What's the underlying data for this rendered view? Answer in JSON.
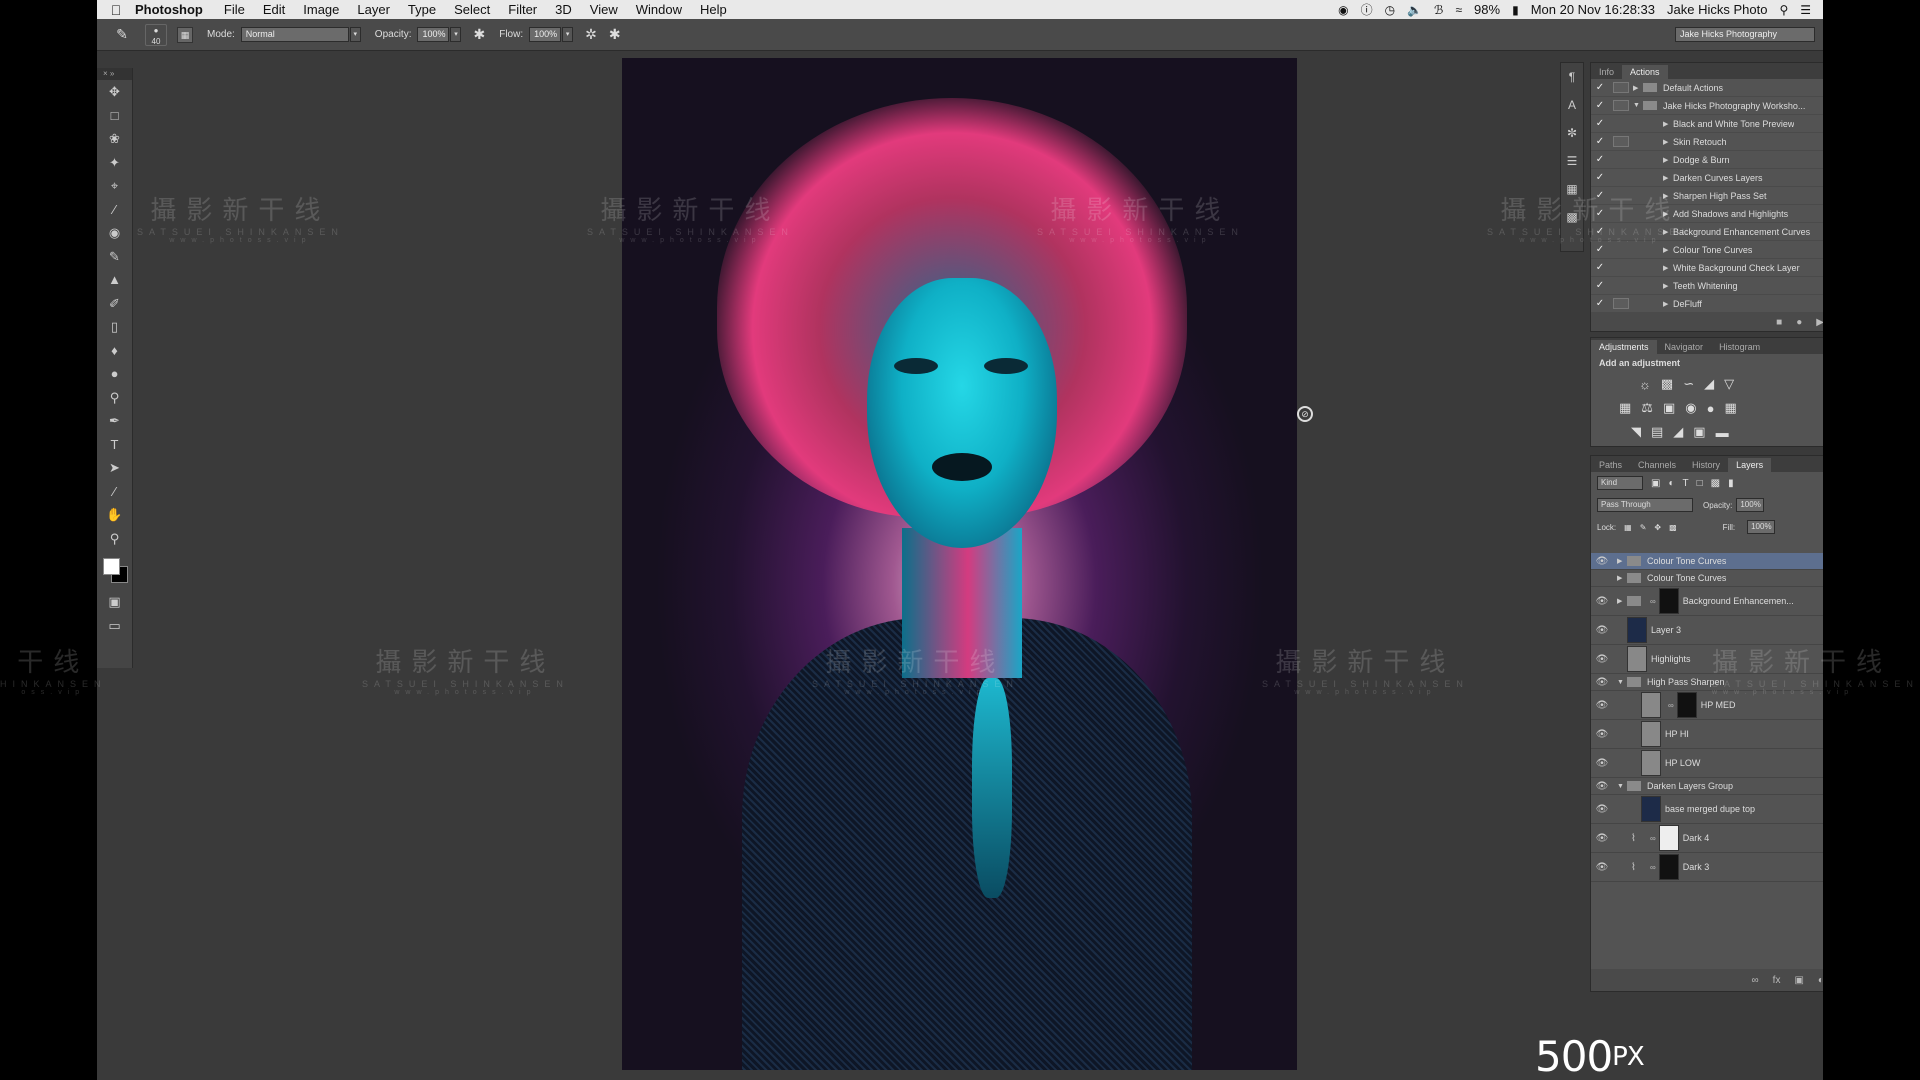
{
  "menubar": {
    "app_name": "Photoshop",
    "menus": [
      "File",
      "Edit",
      "Image",
      "Layer",
      "Type",
      "Select",
      "Filter",
      "3D",
      "View",
      "Window",
      "Help"
    ],
    "battery": "98%",
    "datetime": "Mon 20 Nov  16:28:33",
    "user": "Jake Hicks Photo"
  },
  "options": {
    "brush_size": "40",
    "mode_label": "Mode:",
    "mode_value": "Normal",
    "opacity_label": "Opacity:",
    "opacity_value": "100%",
    "flow_label": "Flow:",
    "flow_value": "100%",
    "preset": "Jake Hicks Photography"
  },
  "watermark": {
    "title": "攝影新干线",
    "title_partial": "干线",
    "subtitle": "SATSUEI SHINKANSEN",
    "subtitle_partial": "HINKANSEN",
    "url": "www.photoss.vip",
    "url_partial": "oss.vip"
  },
  "actions_panel": {
    "tabs": [
      "Info",
      "Actions"
    ],
    "items": [
      {
        "name": "Default Actions",
        "level": 0,
        "expanded": false,
        "dialog": true
      },
      {
        "name": "Jake Hicks Photography Worksho...",
        "level": 0,
        "expanded": true,
        "dialog": true
      },
      {
        "name": "Black and White Tone Preview",
        "level": 1,
        "dialog": false
      },
      {
        "name": "Skin Retouch",
        "level": 1,
        "dialog": true
      },
      {
        "name": "Dodge & Burn",
        "level": 1,
        "dialog": false
      },
      {
        "name": "Darken Curves Layers",
        "level": 1,
        "dialog": false
      },
      {
        "name": "Sharpen High Pass Set",
        "level": 1,
        "dialog": false
      },
      {
        "name": "Add Shadows and Highlights",
        "level": 1,
        "dialog": false
      },
      {
        "name": "Background Enhancement Curves",
        "level": 1,
        "dialog": false
      },
      {
        "name": "Colour Tone Curves",
        "level": 1,
        "dialog": false
      },
      {
        "name": "White Background Check Layer",
        "level": 1,
        "dialog": false
      },
      {
        "name": "Teeth Whitening",
        "level": 1,
        "dialog": false
      },
      {
        "name": "DeFluff",
        "level": 1,
        "dialog": true
      }
    ]
  },
  "adjustments_panel": {
    "tabs": [
      "Adjustments",
      "Navigator",
      "Histogram"
    ],
    "title": "Add an adjustment"
  },
  "layers_panel": {
    "tabs": [
      "Paths",
      "Channels",
      "History",
      "Layers"
    ],
    "kind": "Kind",
    "blend_mode": "Pass Through",
    "opacity_label": "Opacity:",
    "opacity_value": "100%",
    "lock_label": "Lock:",
    "fill_label": "Fill:",
    "fill_value": "100%",
    "layers": [
      {
        "name": "Colour Tone Curves",
        "type": "group",
        "visible": true,
        "selected": true
      },
      {
        "name": "Colour Tone Curves",
        "type": "group",
        "visible": false,
        "selected": false
      },
      {
        "name": "Background Enhancemen...",
        "type": "group-mask",
        "visible": true
      },
      {
        "name": "Layer 3",
        "type": "image",
        "visible": true
      },
      {
        "name": "Highlights",
        "type": "gray",
        "visible": true
      },
      {
        "name": "High Pass Sharpen",
        "type": "group-open",
        "visible": true
      },
      {
        "name": "HP MED",
        "type": "hp-mask",
        "visible": true
      },
      {
        "name": "HP HI",
        "type": "gray-indent",
        "visible": true
      },
      {
        "name": "HP LOW",
        "type": "gray-indent",
        "visible": true
      },
      {
        "name": "Darken Layers Group",
        "type": "group-open",
        "visible": true
      },
      {
        "name": "base merged dupe top",
        "type": "image-indent",
        "visible": true
      },
      {
        "name": "Dark 4",
        "type": "curve-white",
        "visible": true
      },
      {
        "name": "Dark 3",
        "type": "curve-black",
        "visible": true
      }
    ]
  },
  "logo": {
    "text": "500",
    "px": "PX"
  }
}
